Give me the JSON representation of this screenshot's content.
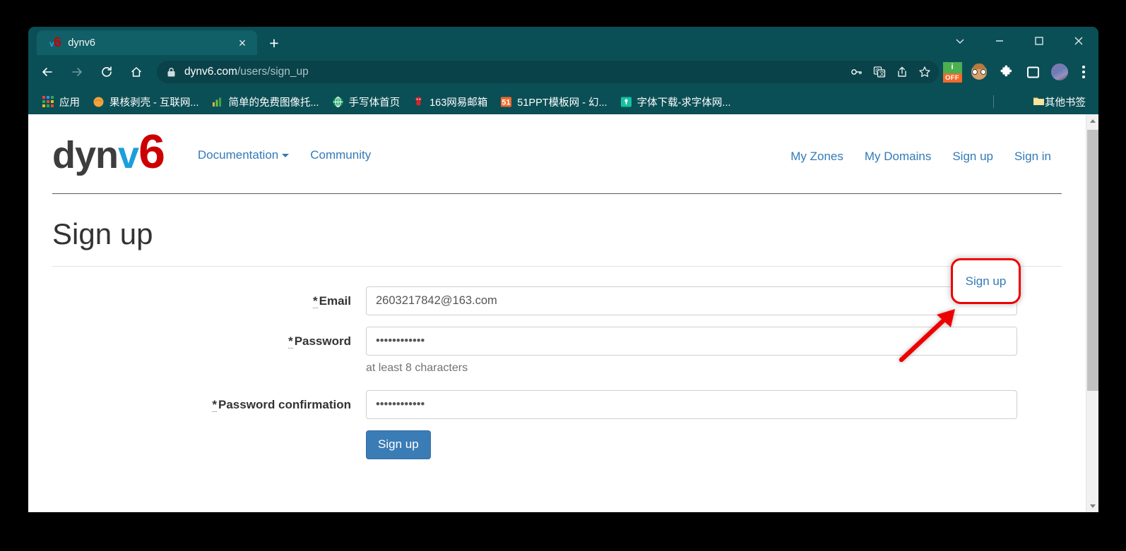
{
  "browser": {
    "tab": {
      "title": "dynv6",
      "favicon": "v6-favicon",
      "close_label": "×"
    },
    "new_tab_label": "+",
    "window_controls": [
      {
        "name": "tab-search",
        "label": "∨"
      },
      {
        "name": "minimize",
        "label": "—"
      },
      {
        "name": "maximize",
        "label": "□"
      },
      {
        "name": "close",
        "label": "×"
      }
    ],
    "toolbar": {
      "back": "back-arrow-icon",
      "forward": "forward-arrow-icon",
      "reload": "reload-icon",
      "home": "home-icon",
      "url_secure": "dynv6.com",
      "url_path": "/users/sign_up",
      "omnibox_icons": [
        "password-key-icon",
        "translate-icon",
        "share-icon",
        "bookmark-star-icon"
      ],
      "extension_badge_top": "i",
      "extension_badge_bottom": "OFF",
      "extensions": [
        "off-extension-icon",
        "glasses-avatar-icon",
        "puzzle-extension-icon",
        "sidebar-panel-icon"
      ],
      "profile": "profile-avatar",
      "menu": "three-dot-menu-icon"
    },
    "bookmarks": [
      {
        "label": "应用",
        "icon": "apps-grid-icon"
      },
      {
        "label": "果核剥壳 - 互联网...",
        "icon": "orange-circle-favicon"
      },
      {
        "label": "简单的免费图像托...",
        "icon": "bar-chart-favicon"
      },
      {
        "label": "手写体首页",
        "icon": "globe-favicon"
      },
      {
        "label": "163网易邮箱",
        "icon": "netease-favicon"
      },
      {
        "label": "51PPT模板网 - 幻...",
        "icon": "51-favicon"
      },
      {
        "label": "字体下载-求字体网...",
        "icon": "teal-pin-favicon"
      }
    ],
    "other_bookmarks": {
      "label": "其他书签",
      "icon": "folder-icon"
    }
  },
  "site": {
    "logo": {
      "part1": "dyn",
      "part2": "v",
      "part3": "6"
    },
    "nav_left": [
      {
        "label": "Documentation",
        "has_caret": true
      },
      {
        "label": "Community",
        "has_caret": false
      }
    ],
    "nav_right": [
      {
        "label": "My Zones"
      },
      {
        "label": "My Domains"
      },
      {
        "label": "Sign up"
      },
      {
        "label": "Sign in"
      }
    ],
    "page_title": "Sign up",
    "form": {
      "fields": [
        {
          "name": "email",
          "required_mark": "*",
          "label": "Email",
          "value": "2603217842@163.com",
          "placeholder": "",
          "type": "text",
          "help": ""
        },
        {
          "name": "password",
          "required_mark": "*",
          "label": "Password",
          "value": "••••••••••••",
          "placeholder": "",
          "type": "text",
          "help": "at least 8 characters"
        },
        {
          "name": "password-confirmation",
          "required_mark": "*",
          "label": "Password confirmation",
          "value": "••••••••••••",
          "placeholder": "",
          "type": "text",
          "help": ""
        }
      ],
      "submit_label": "Sign up"
    }
  },
  "annotations": {
    "highlight_target": "Sign up",
    "highlight_color": "#ee0000",
    "arrow_color": "#ee0000"
  },
  "colors": {
    "browser_chrome": "#0b4f56",
    "tab_active": "#115f67",
    "omnibox": "#0a4249",
    "link_blue": "#337ab7",
    "button_blue": "#3a7cb5",
    "logo_red": "#cc0000",
    "logo_blue": "#1b9fdb",
    "annotation_red": "#ee0000"
  }
}
